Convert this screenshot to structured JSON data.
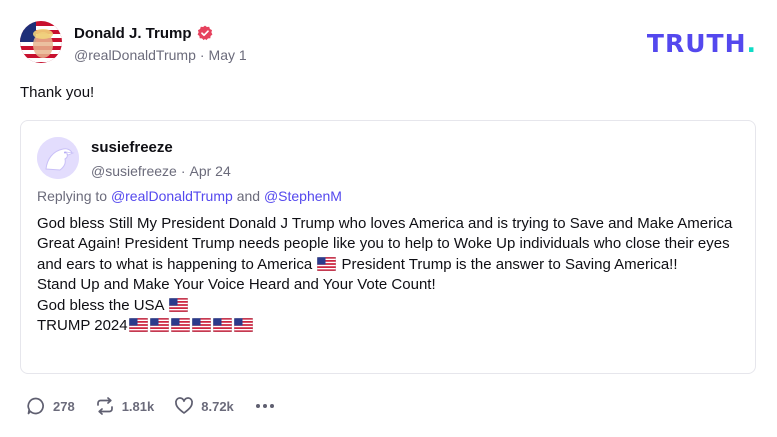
{
  "post": {
    "author_name": "Donald J. Trump",
    "verified_icon": "verified-badge-icon",
    "handle": "@realDonaldTrump",
    "separator": "·",
    "date": "May 1",
    "text": "Thank you!"
  },
  "brand": {
    "logo_text": "TRUTH",
    "logo_dot": ".",
    "logo_color": "#5448ee",
    "dot_color": "#0fdcc6"
  },
  "quote": {
    "author_name": "susiefreeze",
    "handle": "@susiefreeze",
    "separator": "·",
    "date": "Apr 24",
    "replying_prefix": "Replying to",
    "replying_mention_1": "@realDonaldTrump",
    "replying_and": "and",
    "replying_mention_2": "@StephenM",
    "body_line_1a": "God bless Still My President Donald J Trump who loves America and is trying to Save and Make America Great Again! President Trump needs people like you to help to Woke Up individuals who close their eyes and ears to what is happening to America",
    "body_line_1b": "President Trump is the answer to Saving America!!",
    "body_line_2": "Stand Up and Make Your Voice Heard and Your Vote Count!",
    "body_line_3": "God bless the USA",
    "body_line_4": "TRUMP 2024"
  },
  "actions": {
    "replies": "278",
    "retruths": "1.81k",
    "likes": "8.72k"
  },
  "colors": {
    "text": "#0f0f14",
    "muted": "#6b6b7b",
    "accent": "#5448ee",
    "border": "#e6e6ec"
  }
}
